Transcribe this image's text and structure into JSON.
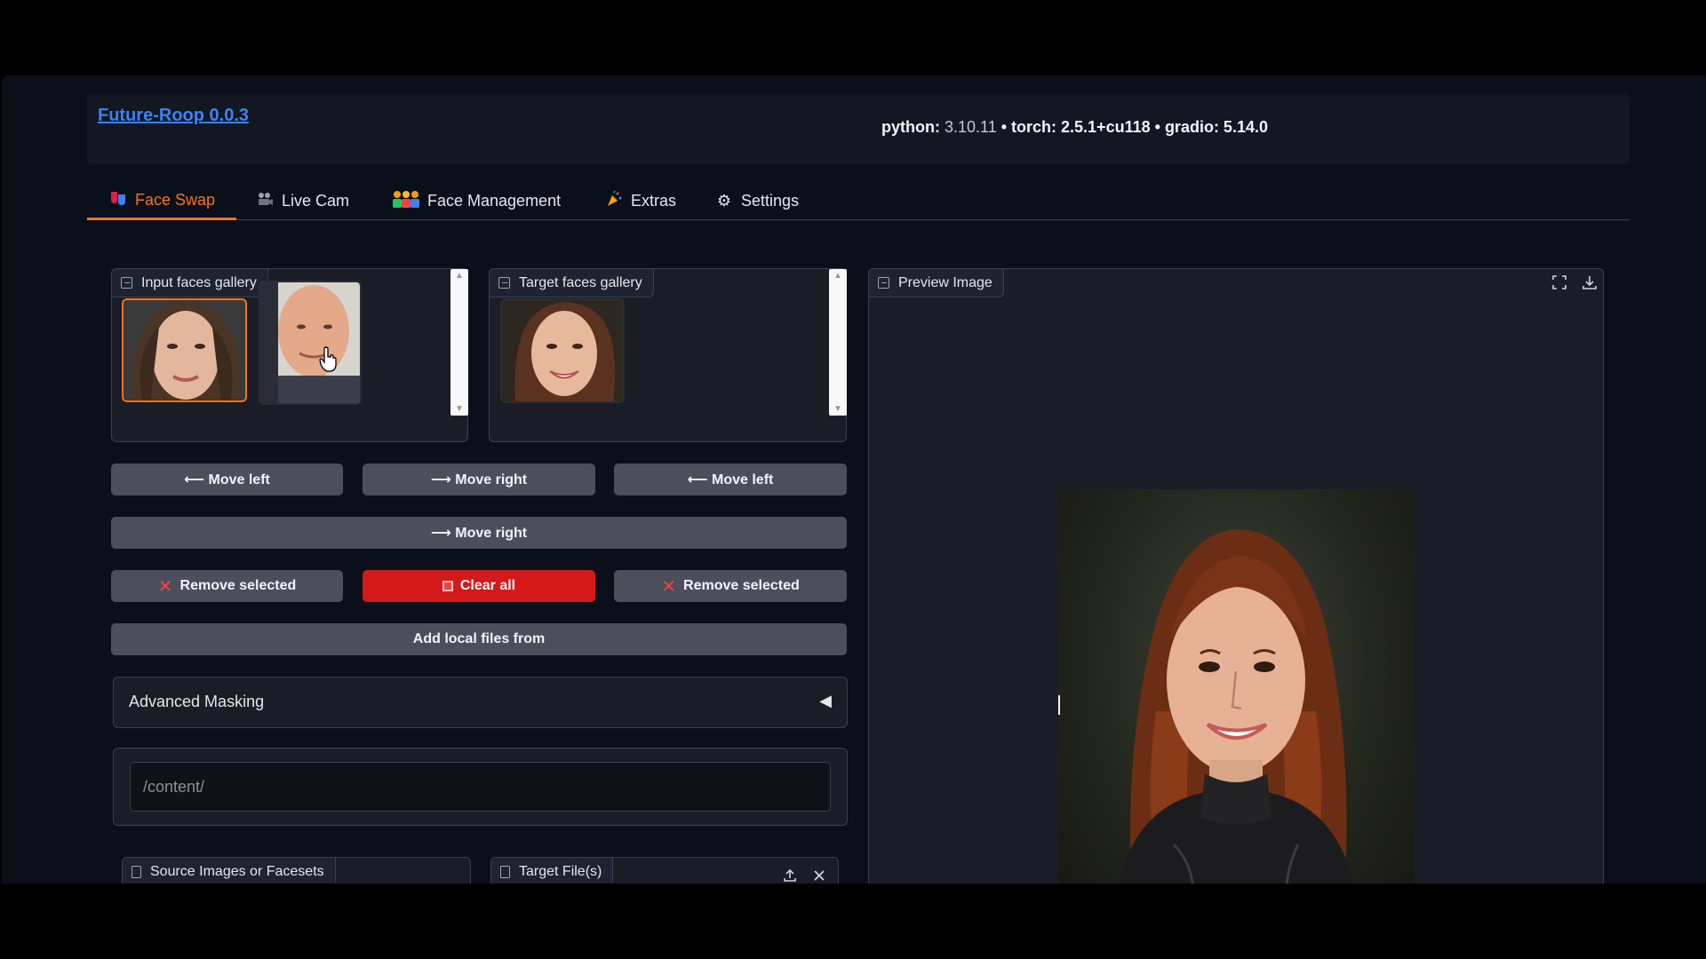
{
  "header": {
    "title": "Future-Roop 0.0.3",
    "python_label": "python: ",
    "python_version": "3.10.11",
    "sep1": " • ",
    "torch": "torch: 2.5.1+cu118",
    "sep2": " • ",
    "gradio": "gradio: 5.14.0"
  },
  "tabs": [
    {
      "label": "Face Swap",
      "icon": "face-swap-icon",
      "active": true
    },
    {
      "label": "Live Cam",
      "icon": "camera-icon",
      "active": false
    },
    {
      "label": "Face Management",
      "icon": "people-icon",
      "active": false
    },
    {
      "label": "Extras",
      "icon": "party-icon",
      "active": false
    },
    {
      "label": "Settings",
      "icon": "gear-icon",
      "active": false
    }
  ],
  "input_gallery": {
    "label": "Input faces gallery",
    "thumbs": [
      "face-woman-portrait",
      "face-bald-man-portrait"
    ]
  },
  "target_gallery": {
    "label": "Target faces gallery",
    "thumbs": [
      "face-young-woman-portrait"
    ]
  },
  "preview": {
    "label": "Preview Image"
  },
  "buttons": {
    "move_left_1": "⟵ Move left",
    "move_right_1": "⟶ Move right",
    "move_left_2": "⟵ Move left",
    "move_right_2": "⟶ Move right",
    "remove_selected_1": "Remove selected",
    "clear_all": "Clear all",
    "remove_selected_2": "Remove selected",
    "add_local": "Add local files from"
  },
  "accordion": {
    "label": "Advanced Masking",
    "state": "collapsed"
  },
  "folder_input": {
    "placeholder": "/content/"
  },
  "source_files": {
    "label": "Source Images or Facesets"
  },
  "target_files": {
    "label": "Target File(s)"
  },
  "colors": {
    "accent": "#f97316",
    "danger": "#d4191a",
    "link": "#3b82f6",
    "background": "#0b0f19"
  }
}
